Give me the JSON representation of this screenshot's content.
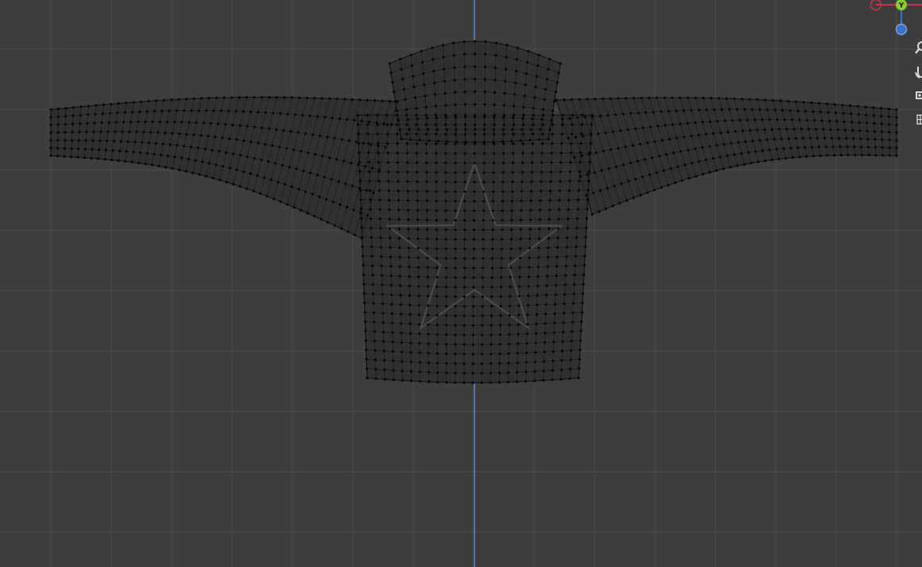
{
  "viewport": {
    "mode": "edit-mode-front-orthographic",
    "background_color": "#3d3d3d",
    "grid_color": "#4a4a4a",
    "axis_z_color": "#5b7fc6",
    "mesh_fill_color": "#2f2f2f",
    "mesh_wire_color": "#141414",
    "vertex_color": "#050505"
  },
  "gizmo": {
    "y_label": "Y",
    "x_color": "#c8364c",
    "y_color": "#8acd3a",
    "z_color": "#3b70c8"
  },
  "tools": [
    {
      "name": "zoom-magnifier-icon"
    },
    {
      "name": "pan-hand-icon"
    },
    {
      "name": "camera-view-icon"
    },
    {
      "name": "perspective-grid-icon"
    }
  ]
}
